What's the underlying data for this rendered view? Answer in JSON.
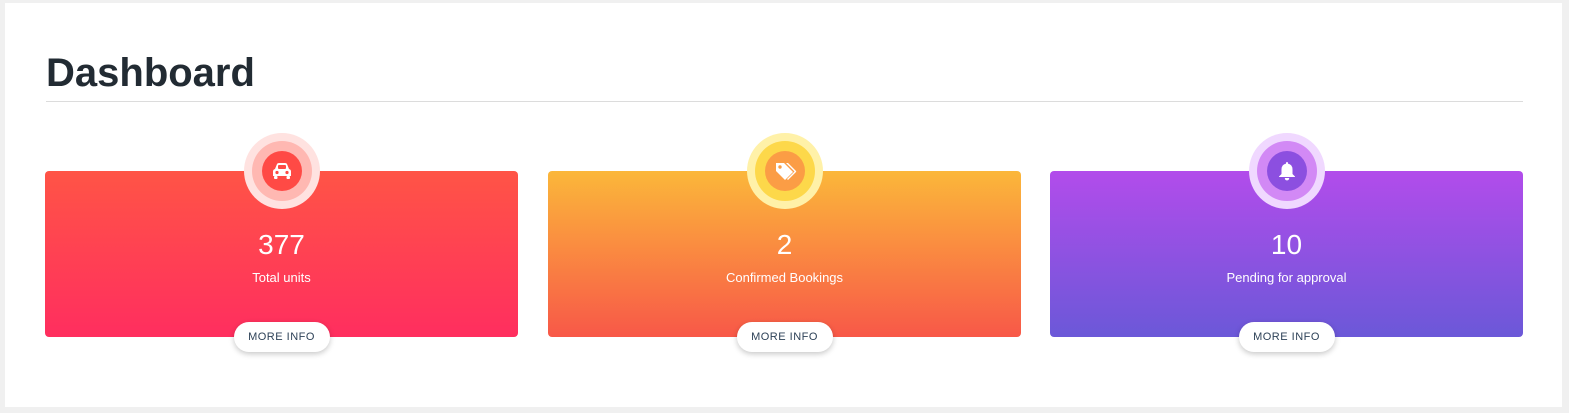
{
  "page": {
    "title": "Dashboard"
  },
  "cards": [
    {
      "value": "377",
      "label": "Total units",
      "button_label": "MORE INFO",
      "icon": "car-icon",
      "gradient": [
        "#ff5446",
        "#ff2e5f"
      ]
    },
    {
      "value": "2",
      "label": "Confirmed Bookings",
      "button_label": "MORE INFO",
      "icon": "tags-icon",
      "gradient": [
        "#fbb73a",
        "#f85848"
      ]
    },
    {
      "value": "10",
      "label": "Pending for approval",
      "button_label": "MORE INFO",
      "icon": "bell-icon",
      "gradient": [
        "#b24ceb",
        "#6b58d8"
      ]
    }
  ]
}
